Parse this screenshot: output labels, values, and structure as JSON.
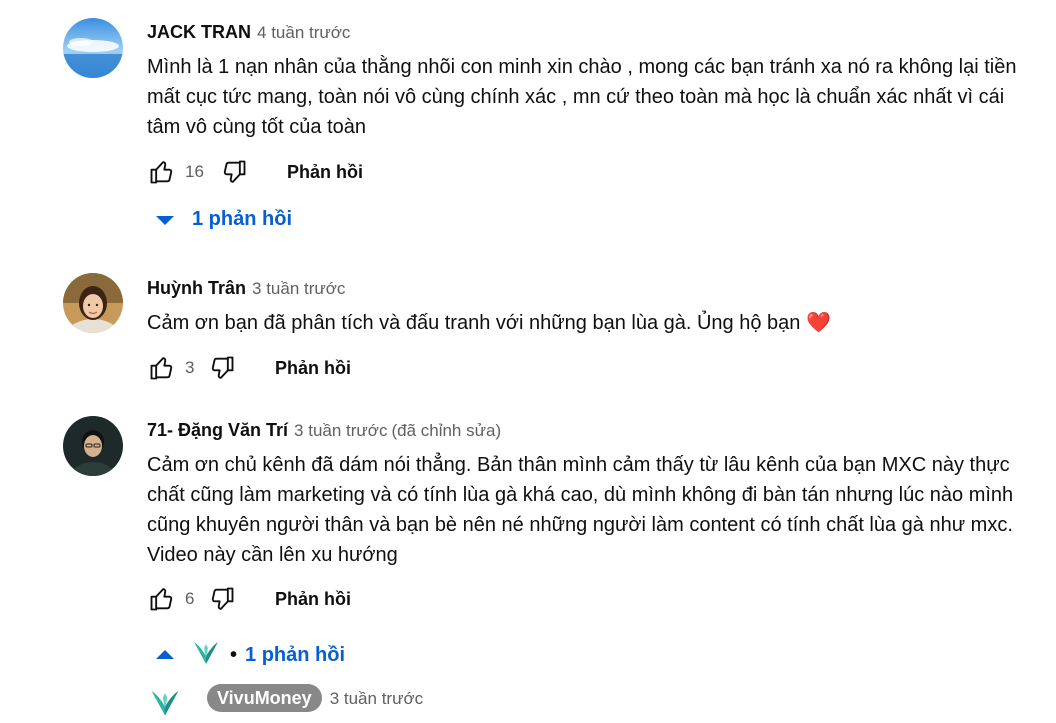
{
  "comments": [
    {
      "author": "JACK TRAN",
      "time": "4 tuần trước",
      "text": "Mình là 1 nạn nhân của thằng nhõi con minh xin chào , mong các bạn tránh xa nó ra không lại tiền mất cục tức mang, toàn nói vô cùng chính xác , mn cứ theo toàn mà học là chuẩn xác nhất vì cái tâm vô cùng tốt của toàn",
      "likes": "16",
      "reply_label": "Phản hồi",
      "replies_label": "1 phản hồi"
    },
    {
      "author": "Huỳnh Trân",
      "time": "3 tuần trước",
      "text": "Cảm ơn bạn đã phân tích và đấu tranh với những bạn lùa gà. Ủng hộ bạn ❤️",
      "likes": "3",
      "reply_label": "Phản hồi"
    },
    {
      "author": "71- Đặng Văn Trí",
      "time": "3 tuần trước",
      "edited": "(đã chỉnh sửa)",
      "text": "Cảm ơn chủ kênh đã dám nói thẳng. Bản thân mình cảm thấy từ lâu kênh của bạn MXC này thực chất cũng làm marketing và có tính lùa gà khá cao, dù mình không đi bàn tán nhưng lúc nào mình cũng khuyên người thân và bạn bè nên né những người làm content có tính chất lùa gà như mxc. Video này cần lên xu hướng",
      "likes": "6",
      "reply_label": "Phản hồi",
      "replies_label": "1 phản hồi",
      "replies_bullet": "•"
    }
  ],
  "reply": {
    "author": "VivuMoney",
    "time": "3 tuần trước"
  },
  "colors": {
    "link": "#065fd4",
    "secondary": "#606060",
    "owner_badge": "#888888",
    "heart": "#e53935",
    "vivu_logo": "#2bb3a3"
  },
  "icons": [
    "like-icon",
    "dislike-icon",
    "chevron-down-icon",
    "chevron-up-icon",
    "vivumoney-logo"
  ]
}
